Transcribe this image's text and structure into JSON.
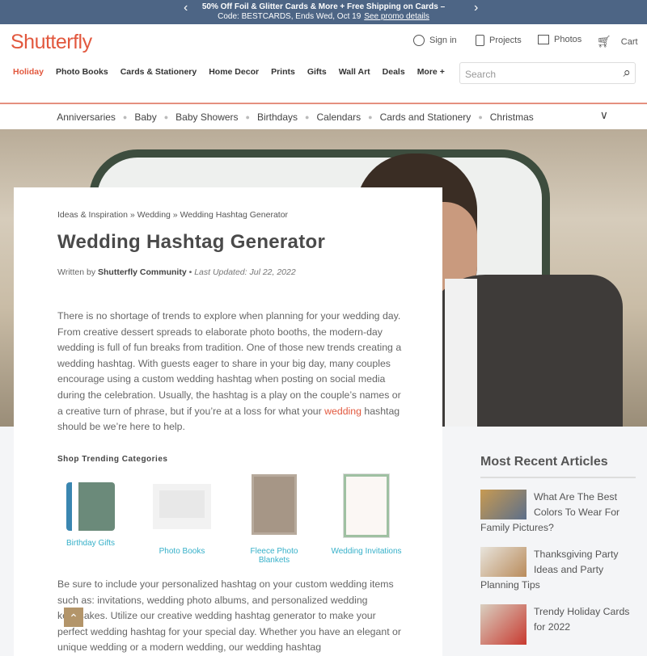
{
  "promo": {
    "line1": "50% Off Foil & Glitter Cards & More + Free Shipping on Cards –",
    "line2": "Code: BESTCARDS, Ends Wed, Oct 19",
    "link": "See promo details",
    "prev": "‹",
    "next": "›"
  },
  "header": {
    "logo": "Shutterfly",
    "sign_in": "Sign in",
    "projects": "Projects",
    "photos": "Photos",
    "cart": "Cart",
    "nav": [
      "Holiday",
      "Photo Books",
      "Cards & Stationery",
      "Home Decor",
      "Prints",
      "Gifts",
      "Wall Art",
      "Deals",
      "More +"
    ],
    "search_placeholder": "Search"
  },
  "categories": [
    "Anniversaries",
    "Baby",
    "Baby Showers",
    "Birthdays",
    "Calendars",
    "Cards and Stationery",
    "Christmas"
  ],
  "article": {
    "breadcrumb": "Ideas & Inspiration » Wedding » Wedding Hashtag Generator",
    "title": "Wedding Hashtag Generator",
    "written_by": "Written by",
    "author": "Shutterfly Community",
    "sep": " • ",
    "updated": "Last Updated: Jul 22, 2022",
    "p1_a": "There is no shortage of trends to explore when planning for your wedding day. From creative dessert spreads to elaborate photo booths, the modern-day wedding is full of fun breaks from tradition. One of those new trends creating a wedding hashtag. With guests eager to share in your big day, many couples encourage using a custom wedding hashtag when posting on social media during the celebration. Usually, the hashtag is a play on the couple’s names or a creative turn of phrase, but if you’re at a loss for what your ",
    "p1_link": "wedding",
    "p1_b": " hashtag should be we’re here to help.",
    "shop_heading": "Shop Trending Categories",
    "products": [
      "Birthday Gifts",
      "Photo Books",
      "Fleece Photo Blankets",
      "Wedding Invitations"
    ],
    "p2": "Be sure to include your personalized hashtag on your custom wedding items such as: invitations, wedding photo albums, and personalized wedding keepsakes. Utilize our creative wedding hashtag generator to make your perfect wedding hashtag for your special day. Whether you have an elegant or unique wedding or a modern wedding, our wedding hashtag"
  },
  "sidebar": {
    "heading": "Most Recent Articles",
    "articles": [
      "What Are The Best Colors To Wear For Family Pictures?",
      "Thanksgiving Party Ideas and Party Planning Tips",
      "Trendy Holiday Cards for 2022"
    ]
  },
  "colors": {
    "brand": "#e2583e",
    "promo_bg": "#4d6585",
    "link": "#36b0c9",
    "back_to_top": "#b3956a"
  }
}
